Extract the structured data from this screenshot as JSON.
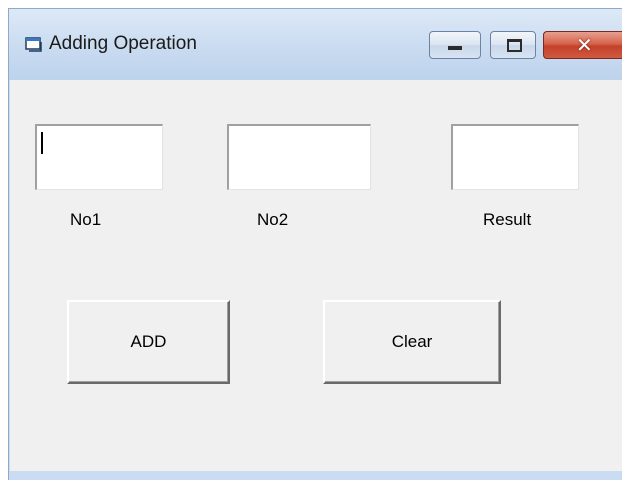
{
  "window": {
    "title": "Adding Operation",
    "icon": "vb-form-icon",
    "controls": {
      "minimize_icon": "minimize-icon",
      "maximize_icon": "maximize-icon",
      "close_glyph": "✕"
    }
  },
  "form": {
    "fields": [
      {
        "label": "No1",
        "value": "",
        "focused": true
      },
      {
        "label": "No2",
        "value": ""
      },
      {
        "label": "Result",
        "value": ""
      }
    ],
    "buttons": {
      "add_label": "ADD",
      "clear_label": "Clear"
    }
  },
  "colors": {
    "titlebar": "#c8daf0",
    "client": "#f0f0f0",
    "close_button": "#c4412a"
  }
}
